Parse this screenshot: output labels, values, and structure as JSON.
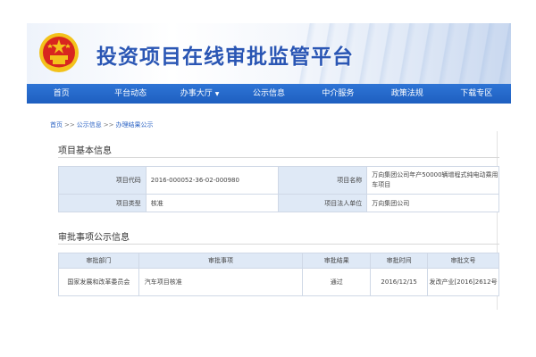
{
  "header": {
    "site_title": "投资项目在线审批监管平台"
  },
  "nav": {
    "items": [
      {
        "label": "首页"
      },
      {
        "label": "平台动态"
      },
      {
        "label": "办事大厅",
        "has_dropdown": true
      },
      {
        "label": "公示信息"
      },
      {
        "label": "中介服务"
      },
      {
        "label": "政策法规"
      },
      {
        "label": "下载专区"
      }
    ]
  },
  "breadcrumb": {
    "items": [
      "首页",
      "公示信息",
      "办理结果公示"
    ],
    "separator": ">>"
  },
  "project_info": {
    "title": "项目基本信息",
    "rows": [
      {
        "label1": "项目代码",
        "value1": "2016-000052-36-02-000980",
        "label2": "项目名称",
        "value2": "万向集团公司年产50000辆增程式纯电动乘用车项目"
      },
      {
        "label1": "项目类型",
        "value1": "核准",
        "label2": "项目法人单位",
        "value2": "万向集团公司"
      }
    ]
  },
  "approval": {
    "title": "审批事项公示信息",
    "headers": [
      "审批部门",
      "审批事项",
      "审批结果",
      "审批时间",
      "审批文号"
    ],
    "rows": [
      {
        "dept": "国家发展和改革委员会",
        "item": "汽车项目核准",
        "result": "通过",
        "date": "2016/12/15",
        "doc_no": "发改产业[2016]2612号"
      }
    ]
  },
  "colors": {
    "nav_bg": "#1e5fc0",
    "title_blue": "#2a56b4",
    "label_bg": "#dfe9f6",
    "emblem_red": "#d8261f",
    "emblem_gold": "#f3c21b"
  }
}
